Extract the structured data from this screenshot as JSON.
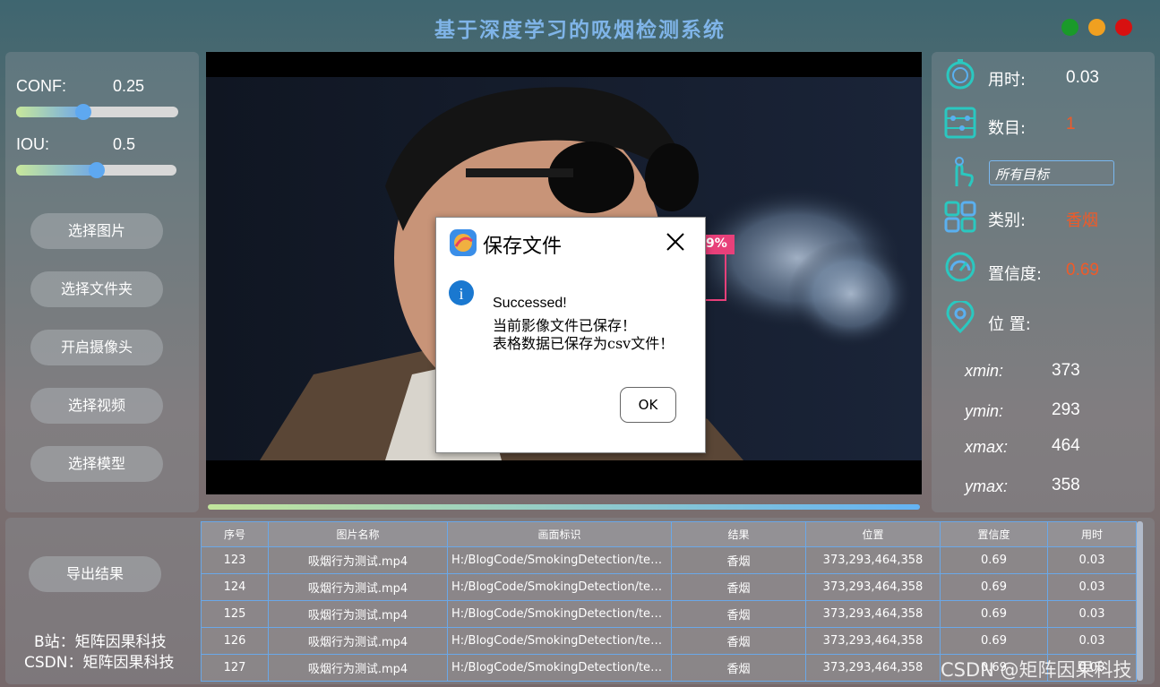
{
  "app": {
    "title": "基于深度学习的吸烟检测系统",
    "window_buttons": [
      {
        "name": "maximize",
        "color": "#1a9a2a"
      },
      {
        "name": "minimize",
        "color": "#f0a020"
      },
      {
        "name": "close",
        "color": "#d81010"
      }
    ]
  },
  "params": {
    "conf_label": "CONF:",
    "conf_value": "0.25",
    "conf_level": 0.25,
    "iou_label": "IOU:",
    "iou_value": "0.5",
    "iou_level": 0.5
  },
  "buttons": {
    "select_image": "选择图片",
    "select_folder": "选择文件夹",
    "open_camera": "开启摄像头",
    "select_video": "选择视频",
    "select_model": "选择模型",
    "export": "导出结果"
  },
  "footer": {
    "bilibili": "B站：矩阵因果科技",
    "csdn": "CSDN：矩阵因果科技",
    "watermark": "CSDN @矩阵因果科技"
  },
  "video": {
    "detection_label": "9%"
  },
  "info": {
    "time_label": "用时:",
    "time_value": "0.03",
    "count_label": "数目:",
    "count_value": "1",
    "target_select": "所有目标",
    "class_label": "类别:",
    "class_value": "香烟",
    "conf_label": "置信度:",
    "conf_value": "0.69",
    "position_label": "位 置:",
    "xmin_label": "xmin:",
    "xmin_value": "373",
    "ymin_label": "ymin:",
    "ymin_value": "293",
    "xmax_label": "xmax:",
    "xmax_value": "464",
    "ymax_label": "ymax:",
    "ymax_value": "358",
    "value_color": "#f05a28",
    "icon_color": "#2ac8c0"
  },
  "table": {
    "headers": [
      "序号",
      "图片名称",
      "画面标识",
      "结果",
      "位置",
      "置信度",
      "用时"
    ],
    "rows": [
      [
        "123",
        "吸烟行为测试.mp4",
        "H:/BlogCode/SmokingDetection/test...",
        "香烟",
        "373,293,464,358",
        "0.69",
        "0.03"
      ],
      [
        "124",
        "吸烟行为测试.mp4",
        "H:/BlogCode/SmokingDetection/test...",
        "香烟",
        "373,293,464,358",
        "0.69",
        "0.03"
      ],
      [
        "125",
        "吸烟行为测试.mp4",
        "H:/BlogCode/SmokingDetection/test...",
        "香烟",
        "373,293,464,358",
        "0.69",
        "0.03"
      ],
      [
        "126",
        "吸烟行为测试.mp4",
        "H:/BlogCode/SmokingDetection/test...",
        "香烟",
        "373,293,464,358",
        "0.69",
        "0.03"
      ],
      [
        "127",
        "吸烟行为测试.mp4",
        "H:/BlogCode/SmokingDetection/test...",
        "香烟",
        "373,293,464,358",
        "0.69",
        "0.03"
      ]
    ]
  },
  "dialog": {
    "title": "保存文件",
    "line1": "Successed!",
    "line2": "当前影像文件已保存！",
    "line3": "表格数据已保存为csv文件！",
    "ok": "OK"
  }
}
